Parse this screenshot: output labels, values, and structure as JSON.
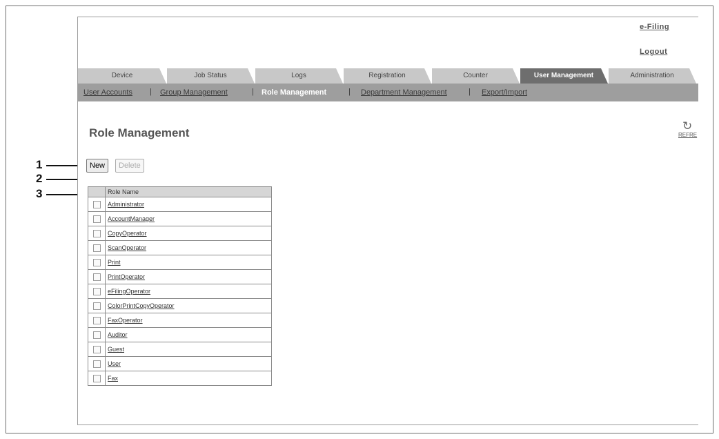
{
  "header": {
    "efiling": "e-Filing",
    "logout": "Logout"
  },
  "tabs": [
    {
      "label": "Device"
    },
    {
      "label": "Job Status"
    },
    {
      "label": "Logs"
    },
    {
      "label": "Registration"
    },
    {
      "label": "Counter"
    },
    {
      "label": "User Management",
      "active": true
    },
    {
      "label": "Administration"
    }
  ],
  "subnav": {
    "items": [
      "User Accounts",
      "Group Management",
      "Role Management",
      "Department Management",
      "Export/Import"
    ],
    "active": "Role Management",
    "separator": "|"
  },
  "page": {
    "title": "Role Management",
    "refresh_label": "REFRE",
    "refresh_icon": "refresh-icon"
  },
  "toolbar": {
    "new_label": "New",
    "delete_label": "Delete"
  },
  "table": {
    "header": "Role Name",
    "rows": [
      "Administrator",
      "AccountManager",
      "CopyOperator",
      "ScanOperator",
      "Print",
      "PrintOperator",
      "eFilingOperator",
      "ColorPrintCopyOperator",
      "FaxOperator",
      "Auditor",
      "Guest",
      "User",
      "Fax"
    ]
  },
  "callouts": [
    "1",
    "2",
    "3"
  ],
  "colors": {
    "active_tab": "#6e6e6e",
    "inactive_tab": "#c8c8c8",
    "subnav": "#9e9e9e"
  }
}
